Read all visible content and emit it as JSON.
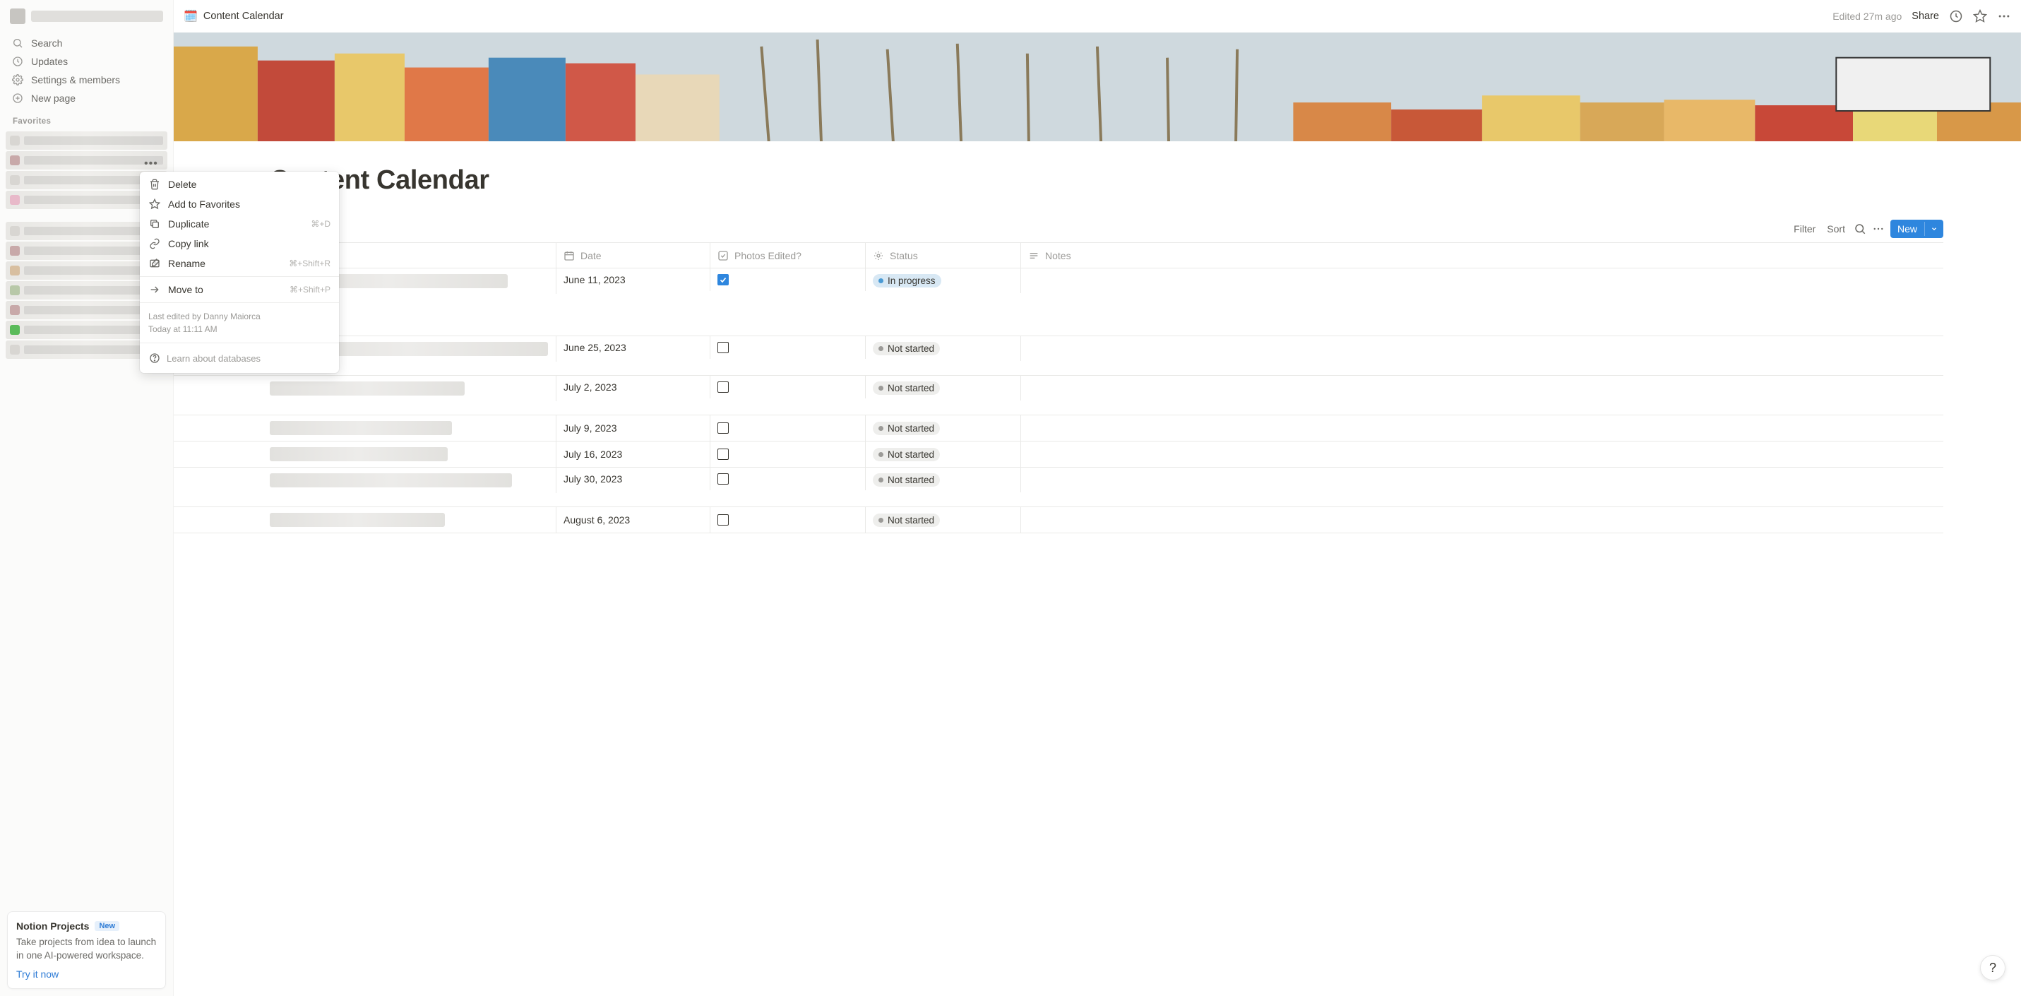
{
  "sidebar": {
    "nav": {
      "search": "Search",
      "updates": "Updates",
      "settings": "Settings & members",
      "new_page": "New page"
    },
    "favorites_label": "Favorites",
    "promo": {
      "title": "Notion Projects",
      "badge": "New",
      "desc": "Take projects from idea to launch in one AI-powered workspace.",
      "cta": "Try it now"
    }
  },
  "topbar": {
    "crumb_icon": "🗓️",
    "crumb_title": "Content Calendar",
    "edited": "Edited 27m ago",
    "share": "Share"
  },
  "page": {
    "title": "tent Calendar",
    "title_full": "Content Calendar"
  },
  "db": {
    "toolbar": {
      "filter": "Filter",
      "sort": "Sort",
      "new": "New"
    },
    "columns": {
      "date": "Date",
      "photos": "Photos Edited?",
      "status": "Status",
      "notes": "Notes"
    },
    "rows": [
      {
        "date": "June 11, 2023",
        "photos_checked": true,
        "status": "In progress",
        "status_kind": "in-progress",
        "height": "tall"
      },
      {
        "date": "June 25, 2023",
        "photos_checked": false,
        "status": "Not started",
        "status_kind": "default",
        "height": "med"
      },
      {
        "date": "July 2, 2023",
        "photos_checked": false,
        "status": "Not started",
        "status_kind": "default",
        "height": "med"
      },
      {
        "date": "July 9, 2023",
        "photos_checked": false,
        "status": "Not started",
        "status_kind": "default",
        "height": ""
      },
      {
        "date": "July 16, 2023",
        "photos_checked": false,
        "status": "Not started",
        "status_kind": "default",
        "height": ""
      },
      {
        "date": "July 30, 2023",
        "photos_checked": false,
        "status": "Not started",
        "status_kind": "default",
        "height": "med"
      },
      {
        "date": "August 6, 2023",
        "photos_checked": false,
        "status": "Not started",
        "status_kind": "default",
        "height": ""
      }
    ]
  },
  "context_menu": {
    "items": [
      {
        "icon": "trash",
        "label": "Delete",
        "shortcut": ""
      },
      {
        "icon": "star",
        "label": "Add to Favorites",
        "shortcut": ""
      },
      {
        "icon": "copy",
        "label": "Duplicate",
        "shortcut": "⌘+D"
      },
      {
        "icon": "link",
        "label": "Copy link",
        "shortcut": ""
      },
      {
        "icon": "rename",
        "label": "Rename",
        "shortcut": "⌘+Shift+R"
      }
    ],
    "move_to": {
      "label": "Move to",
      "shortcut": "⌘+Shift+P"
    },
    "meta_line1": "Last edited by Danny Maiorca",
    "meta_line2": "Today at 11:11 AM",
    "learn": "Learn about databases"
  },
  "help": "?"
}
